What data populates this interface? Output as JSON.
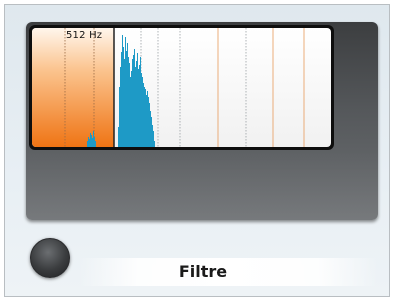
{
  "app": {
    "frequency_label": "512 Hz",
    "title": "Filtre"
  },
  "colors": {
    "accent_orange": "#f07a1c",
    "spectrum_blue": "#1e9ac6",
    "panel_dark": "#4a4c4e"
  },
  "icons": {
    "knob": "round-knob-icon"
  }
}
